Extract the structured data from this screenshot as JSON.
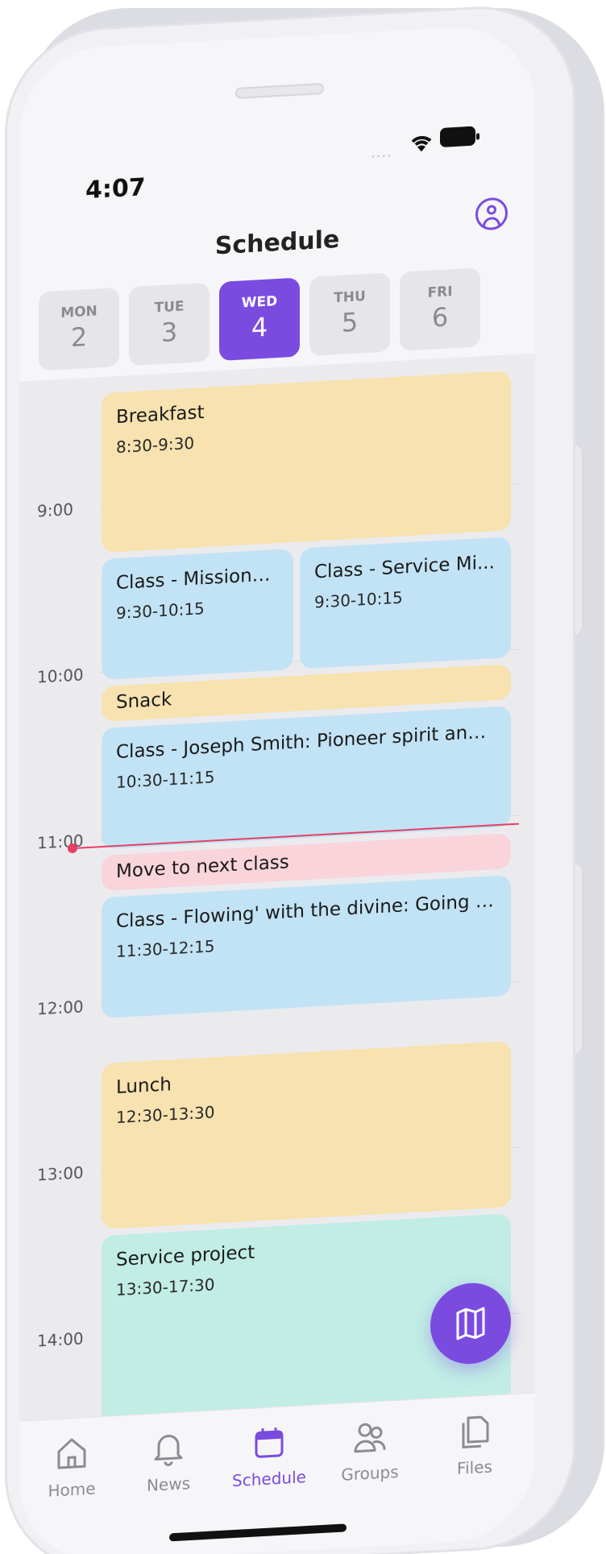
{
  "status_bar": {
    "time": "4:07",
    "dots": "....",
    "wifi_icon": "wifi-icon",
    "battery_icon": "battery-icon"
  },
  "header": {
    "title": "Schedule",
    "profile_icon": "user-circle-icon"
  },
  "days": [
    {
      "name": "MON",
      "num": "2"
    },
    {
      "name": "TUE",
      "num": "3"
    },
    {
      "name": "WED",
      "num": "4"
    },
    {
      "name": "THU",
      "num": "5"
    },
    {
      "name": "FRI",
      "num": "6"
    }
  ],
  "selected_day_index": 2,
  "hours": [
    "9:00",
    "10:00",
    "11:00",
    "12:00",
    "13:00",
    "14:00"
  ],
  "events": [
    {
      "title": "Breakfast",
      "time": "8:30-9:30",
      "color": "#f7e2b0"
    },
    {
      "title": "Class - Missionar...",
      "time": "9:30-10:15",
      "color": "#c2e3f5"
    },
    {
      "title": "Class - Service Mi...",
      "time": "9:30-10:15",
      "color": "#c2e3f5"
    },
    {
      "title": "Snack",
      "color": "#f7e2b0"
    },
    {
      "title": "Class - Joseph Smith: Pioneer spirit and jo...",
      "time": "10:30-11:15",
      "color": "#c2e3f5"
    },
    {
      "title": "Move to next class",
      "color": "#f9d4db"
    },
    {
      "title": "Class - Flowing' with the divine: Going wit...",
      "time": "11:30-12:15",
      "color": "#c2e3f5"
    },
    {
      "title": "Lunch",
      "time": "12:30-13:30",
      "color": "#f7e2b0"
    },
    {
      "title": "Service project",
      "time": "13:30-17:30",
      "color": "#c1ede5"
    }
  ],
  "current_time_indicator": {
    "color": "#e83e66"
  },
  "fab": {
    "icon": "map-icon"
  },
  "nav": [
    {
      "label": "Home",
      "icon": "home-icon"
    },
    {
      "label": "News",
      "icon": "bell-icon"
    },
    {
      "label": "Schedule",
      "icon": "calendar-icon"
    },
    {
      "label": "Groups",
      "icon": "users-icon"
    },
    {
      "label": "Files",
      "icon": "files-icon"
    }
  ],
  "active_nav_index": 2,
  "accent_color": "#7b4be0"
}
